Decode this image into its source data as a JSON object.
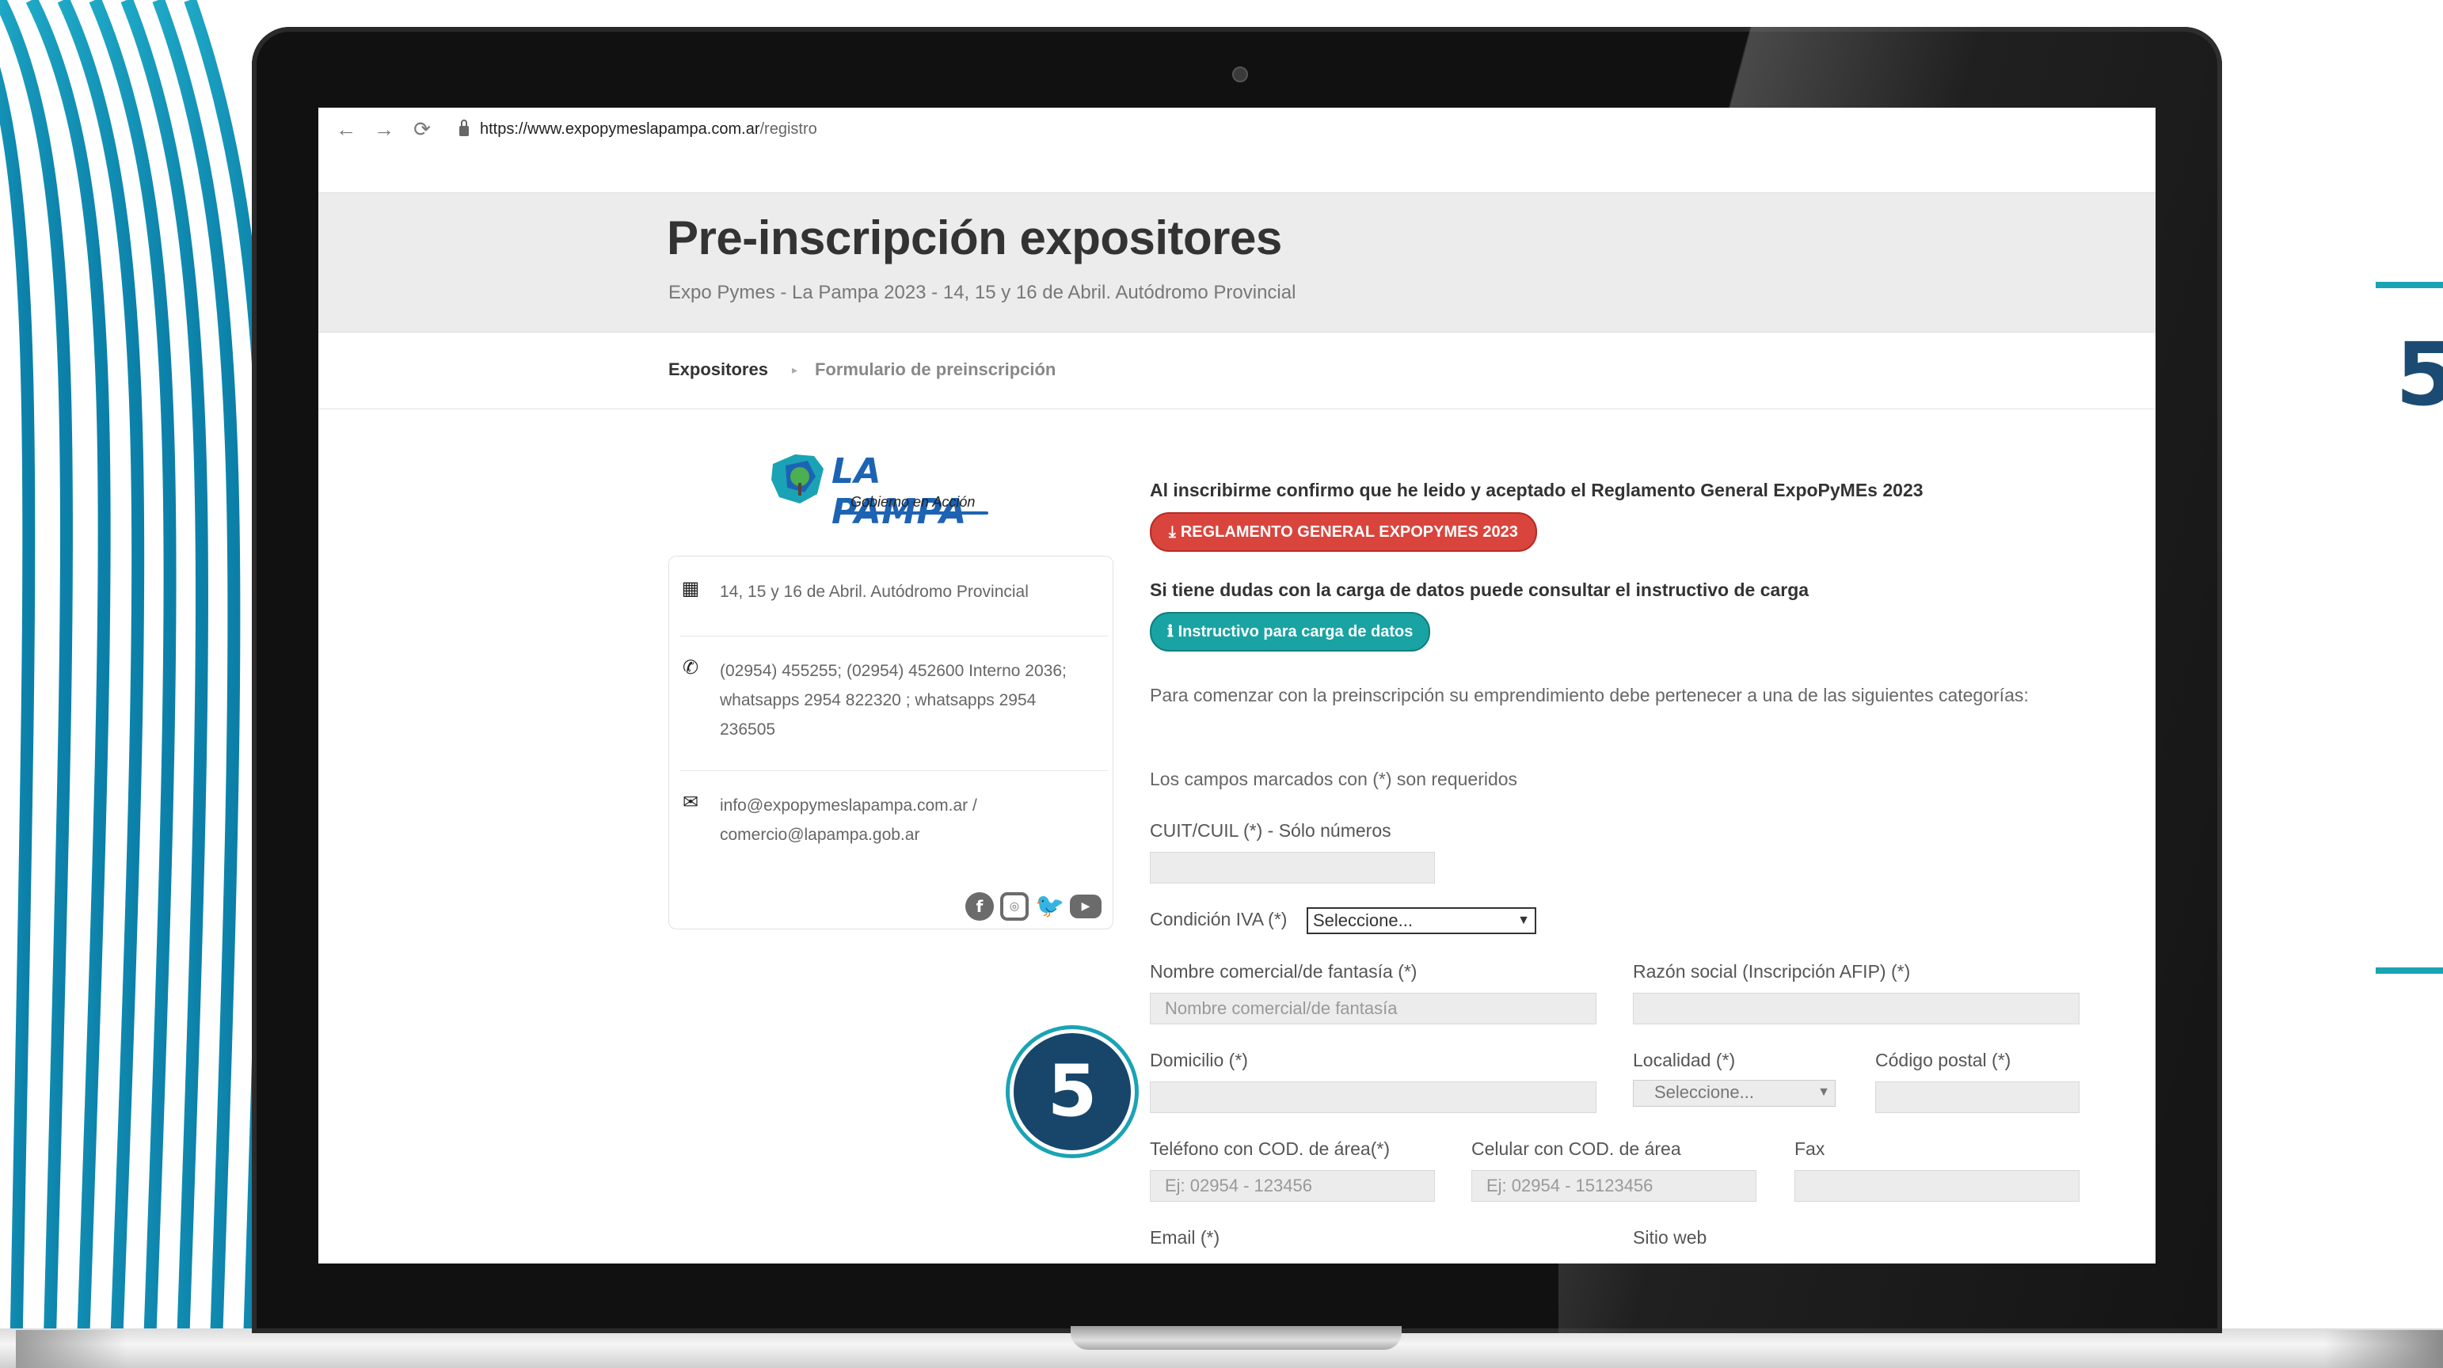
{
  "browser": {
    "url_host": "https://www.expopymeslapampa.com.ar",
    "url_path": "/registro",
    "back_icon": "←",
    "forward_icon": "→",
    "reload_icon": "⟳"
  },
  "header": {
    "title": "Pre-inscripción expositores",
    "subtitle": "Expo Pymes - La Pampa 2023 - 14, 15 y 16 de Abril. Autódromo Provincial"
  },
  "breadcrumb": {
    "item1": "Expositores",
    "separator": "▸",
    "item2": "Formulario de preinscripción"
  },
  "logo": {
    "name": "LA PAMPA",
    "tagline": "Gobierno en Acción"
  },
  "sidebar": {
    "date_icon": "▦",
    "date": "14, 15 y 16 de Abril. Autódromo Provincial",
    "phone_icon": "✆",
    "phone": "(02954) 455255; (02954) 452600 Interno 2036; whatsapps 2954 822320 ; whatsapps 2954 236505",
    "email_icon": "✉",
    "email": "info@expopymeslapampa.com.ar / comercio@lapampa.gob.ar",
    "socials": {
      "facebook": "f",
      "instagram": "◎",
      "twitter": "🐦",
      "youtube": "▶"
    }
  },
  "form": {
    "reglamento_notice": "Al inscribirme confirmo que he leido y aceptado el Reglamento General ExpoPyMEs 2023",
    "reglamento_button": "REGLAMENTO GENERAL EXPOPYMES 2023",
    "download_icon": "⤓",
    "instructivo_notice": "Si tiene dudas con la carga de datos puede consultar el instructivo de carga",
    "instructivo_button": "Instructivo para carga de datos",
    "info_icon": "ℹ",
    "intro": "Para comenzar con la preinscripción su emprendimiento debe pertenecer a una de las siguientes categorías:",
    "required_note": "Los campos marcados con (*) son requeridos",
    "cuit_label": "CUIT/CUIL (*) - Sólo números",
    "cuit_value": "",
    "iva_label": "Condición IVA (*)",
    "iva_selected": "Seleccione...",
    "nombre_label": "Nombre comercial/de fantasía (*)",
    "nombre_placeholder": "Nombre comercial/de fantasía",
    "razon_label": "Razón social (Inscripción AFIP) (*)",
    "razon_value": "",
    "domicilio_label": "Domicilio (*)",
    "domicilio_value": "",
    "localidad_label": "Localidad (*)",
    "localidad_selected": "Seleccione...",
    "cp_label": "Código postal (*)",
    "cp_value": "",
    "telefono_label": "Teléfono con COD. de área(*)",
    "telefono_placeholder": "Ej: 02954 - 123456",
    "celular_label": "Celular con COD. de área",
    "celular_placeholder": "Ej: 02954 - 15123456",
    "fax_label": "Fax",
    "fax_value": "",
    "email_label": "Email (*)",
    "web_label": "Sitio web"
  },
  "step": {
    "number": "5",
    "side_number": "5"
  },
  "colors": {
    "accent_teal": "#1aa3b5",
    "badge_navy": "#17466a",
    "button_red": "#d9453d",
    "button_teal": "#1aa3a3",
    "logo_blue": "#1d63b4"
  }
}
